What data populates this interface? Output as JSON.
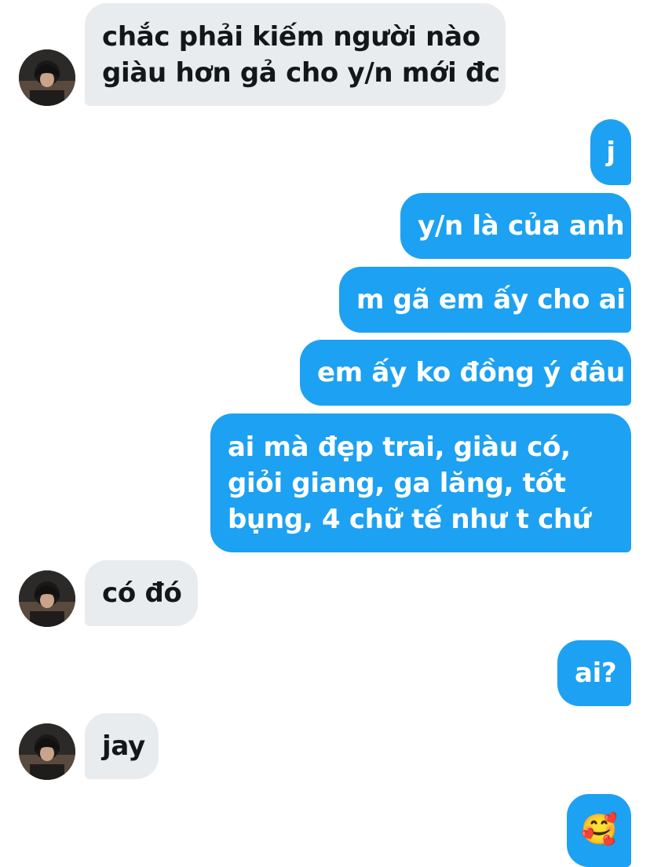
{
  "conversation": {
    "messages": [
      {
        "side": "incoming",
        "text_lines": [
          "chắc phải kiếm người nào",
          "giàu hơn gả cho y/n mới đc"
        ]
      },
      {
        "side": "outgoing",
        "text": "j"
      },
      {
        "side": "outgoing",
        "text": "y/n là của anh"
      },
      {
        "side": "outgoing",
        "text": "m gã em ấy cho ai"
      },
      {
        "side": "outgoing",
        "text": "em ấy ko đồng ý đâu"
      },
      {
        "side": "outgoing",
        "text_lines": [
          "ai mà đẹp trai, giàu có,",
          "giỏi giang, ga lăng, tốt",
          "bụng, 4 chữ tế như t chứ"
        ]
      },
      {
        "side": "incoming",
        "text": "có đó"
      },
      {
        "side": "outgoing",
        "text": "ai?"
      },
      {
        "side": "incoming",
        "text": "jay"
      },
      {
        "side": "outgoing",
        "text": "🥰"
      }
    ]
  },
  "colors": {
    "outgoing_bubble": "#1da1f2",
    "incoming_bubble": "#e9ecef",
    "outgoing_text": "#ffffff",
    "incoming_text": "#14171a"
  },
  "icons": {
    "avatar": "profile-photo-avatar",
    "emoji": "smiling-face-with-hearts-emoji"
  }
}
